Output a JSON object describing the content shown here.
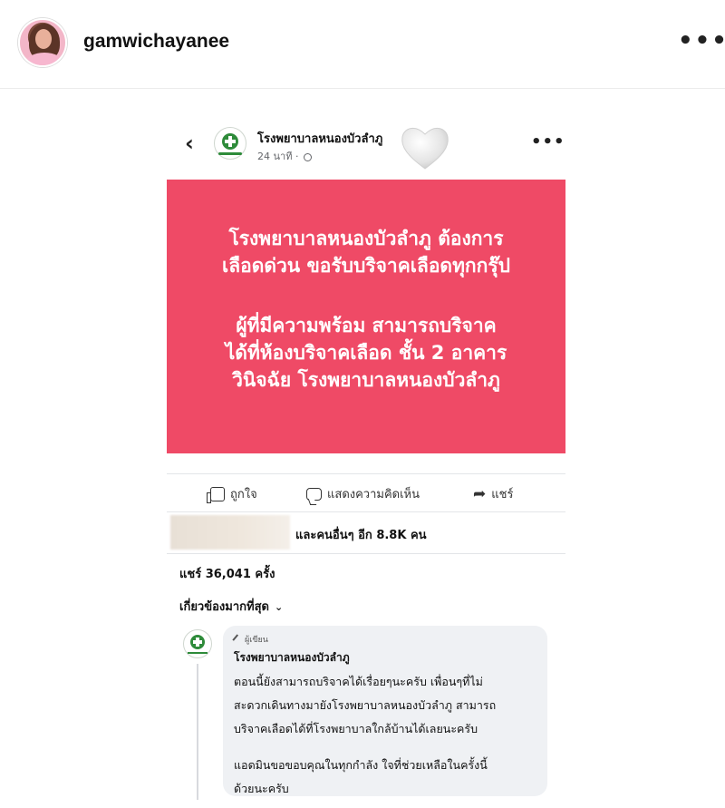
{
  "instagram": {
    "username": "gamwichayanee",
    "more_label": "•••"
  },
  "facebook_post": {
    "back_label": "‹",
    "page_name": "โรงพยาบาลหนองบัวลำภู",
    "time": "24 นาที ·",
    "more_label": "•••",
    "banner_lines_1": [
      "โรงพยาบาลหนองบัวลำภู  ต้องการ",
      "เลือดด่วน ขอรับบริจาคเลือดทุกกรุ๊ป"
    ],
    "banner_lines_2": [
      "ผู้ที่มีความพร้อม สามารถบริจาค",
      "ได้ที่ห้องบริจาคเลือด ชั้น 2 อาคาร",
      "วินิจฉัย โรงพยาบาลหนองบัวลำภู"
    ],
    "banner_color": "#ef4a66",
    "actions": {
      "like": "ถูกใจ",
      "comment": "แสดงความคิดเห็น",
      "share": "แชร์"
    },
    "reactors_text": "และคนอื่นๆ อีก 8.8K คน",
    "shares_text": "แชร์ 36,041 ครั้ง",
    "sort_label": "เกี่ยวข้องมากที่สุด",
    "comment": {
      "badge": "ผู้เขียน",
      "author": "โรงพยาบาลหนองบัวลำภู",
      "lines_1": [
        "ตอนนี้ยังสามารถบริจาคได้เรื่อยๆนะครับ  เพื่อนๆที่ไม่",
        "สะดวกเดินทางมายังโรงพยาบาลหนองบัวลำภู สามารถ",
        "บริจาคเลือดได้ที่โรงพยาบาลใกล้บ้านได้เลยนะครับ"
      ],
      "lines_2": [
        "แอดมินขอขอบคุณในทุกกำลัง ใจที่ช่วยเหลือในครั้งนี้",
        "ด้วยนะครับ"
      ]
    }
  }
}
